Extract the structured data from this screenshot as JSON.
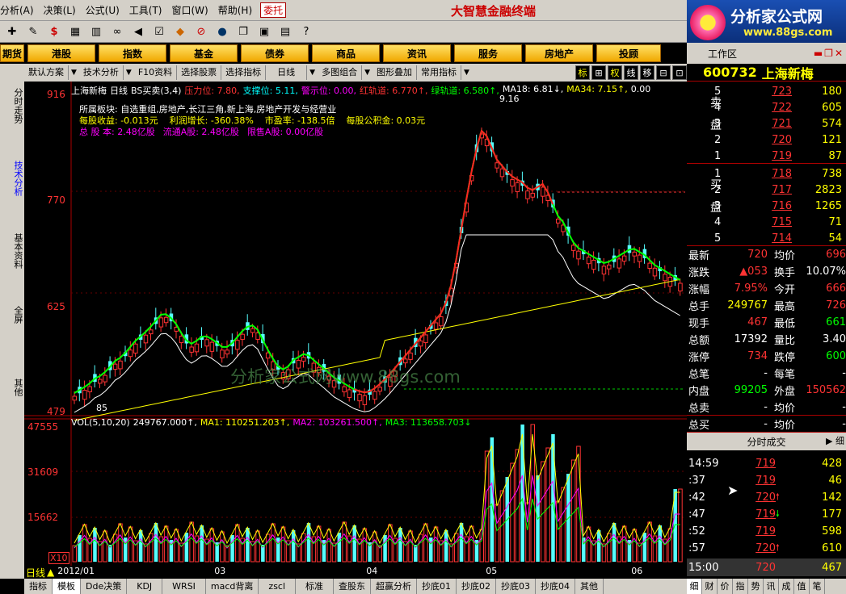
{
  "menu": {
    "items": [
      "分析(A)",
      "决策(L)",
      "公式(U)",
      "工具(T)",
      "窗口(W)",
      "帮助(H)"
    ],
    "entrust": "委托",
    "app_title": "大智慧金融终端"
  },
  "brand": {
    "title": "分析家公式网",
    "url": "www.88gs.com"
  },
  "nav": {
    "items": [
      "期货",
      "港股",
      "指数",
      "基金",
      "债券",
      "商品",
      "资讯",
      "服务",
      "房地产",
      "投顾"
    ],
    "workarea": "工作区"
  },
  "left_tabs": [
    "分时走势",
    "技术分析",
    "基本资料",
    "全屏",
    "其他"
  ],
  "toolbar2": {
    "items": [
      "默认方案",
      "技术分析",
      "F10资料",
      "选择股票",
      "选择指标",
      "日线",
      "多图组合",
      "图形叠加",
      "常用指标"
    ],
    "right_buttons": [
      "标",
      "⊞",
      "权",
      "线",
      "移",
      "⊟",
      "⊡"
    ]
  },
  "chart": {
    "header": {
      "stock": "上海新梅",
      "period": "日线",
      "indicator": "BS买卖(3,4)",
      "pressure": "压力位: 7.80,",
      "support": "支撑位: 5.11,",
      "warning": "警示位: 0.00,",
      "red_track": "红轨道: 6.770↑,",
      "green_track": "绿轨道: 6.580↑,",
      "ma18": "MA18: 6.81↓,",
      "ma34": "MA34: 7.15↑,",
      "tail": "0.00"
    },
    "info": {
      "sector_label": "所属板块:",
      "sector_value": "自选重组,房地产,长江三角,新上海,房地产开发与经营业",
      "eps": "每股收益: -0.013元",
      "profit_growth": "利润增长: -360.38%",
      "pe": "市盈率: -138.5倍",
      "fund": "每股公积金: 0.03元",
      "total_shares": "总 股 本: 2.48亿股",
      "float_shares": "流通A股: 2.48亿股",
      "restricted": "限售A股: 0.00亿股"
    },
    "price_axis": [
      "916",
      "770",
      "625",
      "479"
    ],
    "peak_label": "9.16",
    "low_label": "85",
    "vol_axis": [
      "47555",
      "31609",
      "15662"
    ],
    "vol_multiplier": "X10",
    "vol_header": {
      "label": "VOL(5,10,20)",
      "vol": "249767.000↑,",
      "ma1": "MA1: 110251.203↑,",
      "ma2": "MA2: 103261.500↑,",
      "ma3": "MA3: 113658.703↓"
    },
    "watermark": "分析家公式网www.88gs.com"
  },
  "bottom": {
    "period": "日线",
    "dates": [
      "2012/01",
      "03",
      "04",
      "05",
      "06"
    ]
  },
  "bottom_tabs": [
    "指标",
    "模板",
    "Dde决策",
    "KDJ",
    "WRSI",
    "macd背离",
    "zscl",
    "标准",
    "查股东",
    "超赢分析",
    "抄底01",
    "抄底02",
    "抄底03",
    "抄底04",
    "其他"
  ],
  "quote": {
    "code": "600732",
    "name": "上海新梅",
    "sell_label": "卖盘",
    "buy_label": "买盘",
    "sell": [
      {
        "i": "5",
        "p": "723",
        "v": "180"
      },
      {
        "i": "4",
        "p": "722",
        "v": "605"
      },
      {
        "i": "3",
        "p": "721",
        "v": "574"
      },
      {
        "i": "2",
        "p": "720",
        "v": "121"
      },
      {
        "i": "1",
        "p": "719",
        "v": "87"
      }
    ],
    "buy": [
      {
        "i": "1",
        "p": "718",
        "v": "738"
      },
      {
        "i": "2",
        "p": "717",
        "v": "2823"
      },
      {
        "i": "3",
        "p": "716",
        "v": "1265"
      },
      {
        "i": "4",
        "p": "715",
        "v": "71"
      },
      {
        "i": "5",
        "p": "714",
        "v": "54"
      }
    ],
    "stats": [
      {
        "k": "最新",
        "a": "720",
        "ac": "red",
        "k2": "均价",
        "b": "696",
        "bc": "red"
      },
      {
        "k": "涨跌",
        "a": "▲053",
        "ac": "red",
        "k2": "换手",
        "b": "10.07%",
        "bc": "wht"
      },
      {
        "k": "涨幅",
        "a": "7.95%",
        "ac": "red",
        "k2": "今开",
        "b": "666",
        "bc": "red"
      },
      {
        "k": "总手",
        "a": "249767",
        "ac": "yel",
        "k2": "最高",
        "b": "726",
        "bc": "red"
      },
      {
        "k": "现手",
        "a": "467",
        "ac": "red",
        "k2": "最低",
        "b": "661",
        "bc": "grn"
      },
      {
        "k": "总额",
        "a": "17392",
        "ac": "wht",
        "k2": "量比",
        "b": "3.40",
        "bc": "wht"
      },
      {
        "k": "涨停",
        "a": "734",
        "ac": "red",
        "k2": "跌停",
        "b": "600",
        "bc": "grn"
      },
      {
        "k": "总笔",
        "a": "-",
        "ac": "wht",
        "k2": "每笔",
        "b": "-",
        "bc": "wht"
      },
      {
        "k": "内盘",
        "a": "99205",
        "ac": "grn",
        "k2": "外盘",
        "b": "150562",
        "bc": "red"
      },
      {
        "k": "总卖",
        "a": "-",
        "ac": "wht",
        "k2": "均价",
        "b": "-",
        "bc": "wht"
      }
    ],
    "total_buy": {
      "k": "总买",
      "a": "-",
      "k2": "均价",
      "b": "-"
    },
    "trade_title": "分时成交",
    "trade_btn": "▶ 细",
    "trades": [
      {
        "t": "14:59",
        "p": "719",
        "ar": "",
        "v": "428"
      },
      {
        "t": ":37",
        "p": "719",
        "ar": "",
        "v": "46"
      },
      {
        "t": ":42",
        "p": "720",
        "ar": "up",
        "v": "142"
      },
      {
        "t": ":47",
        "p": "719",
        "ar": "down",
        "v": "177"
      },
      {
        "t": ":52",
        "p": "719",
        "ar": "",
        "v": "598"
      },
      {
        "t": ":57",
        "p": "720",
        "ar": "up",
        "v": "610"
      }
    ],
    "last": {
      "t": "15:00",
      "p": "720",
      "v": "467"
    },
    "tabs": [
      "细",
      "财",
      "价",
      "指",
      "势",
      "讯",
      "成",
      "值",
      "笔"
    ]
  }
}
